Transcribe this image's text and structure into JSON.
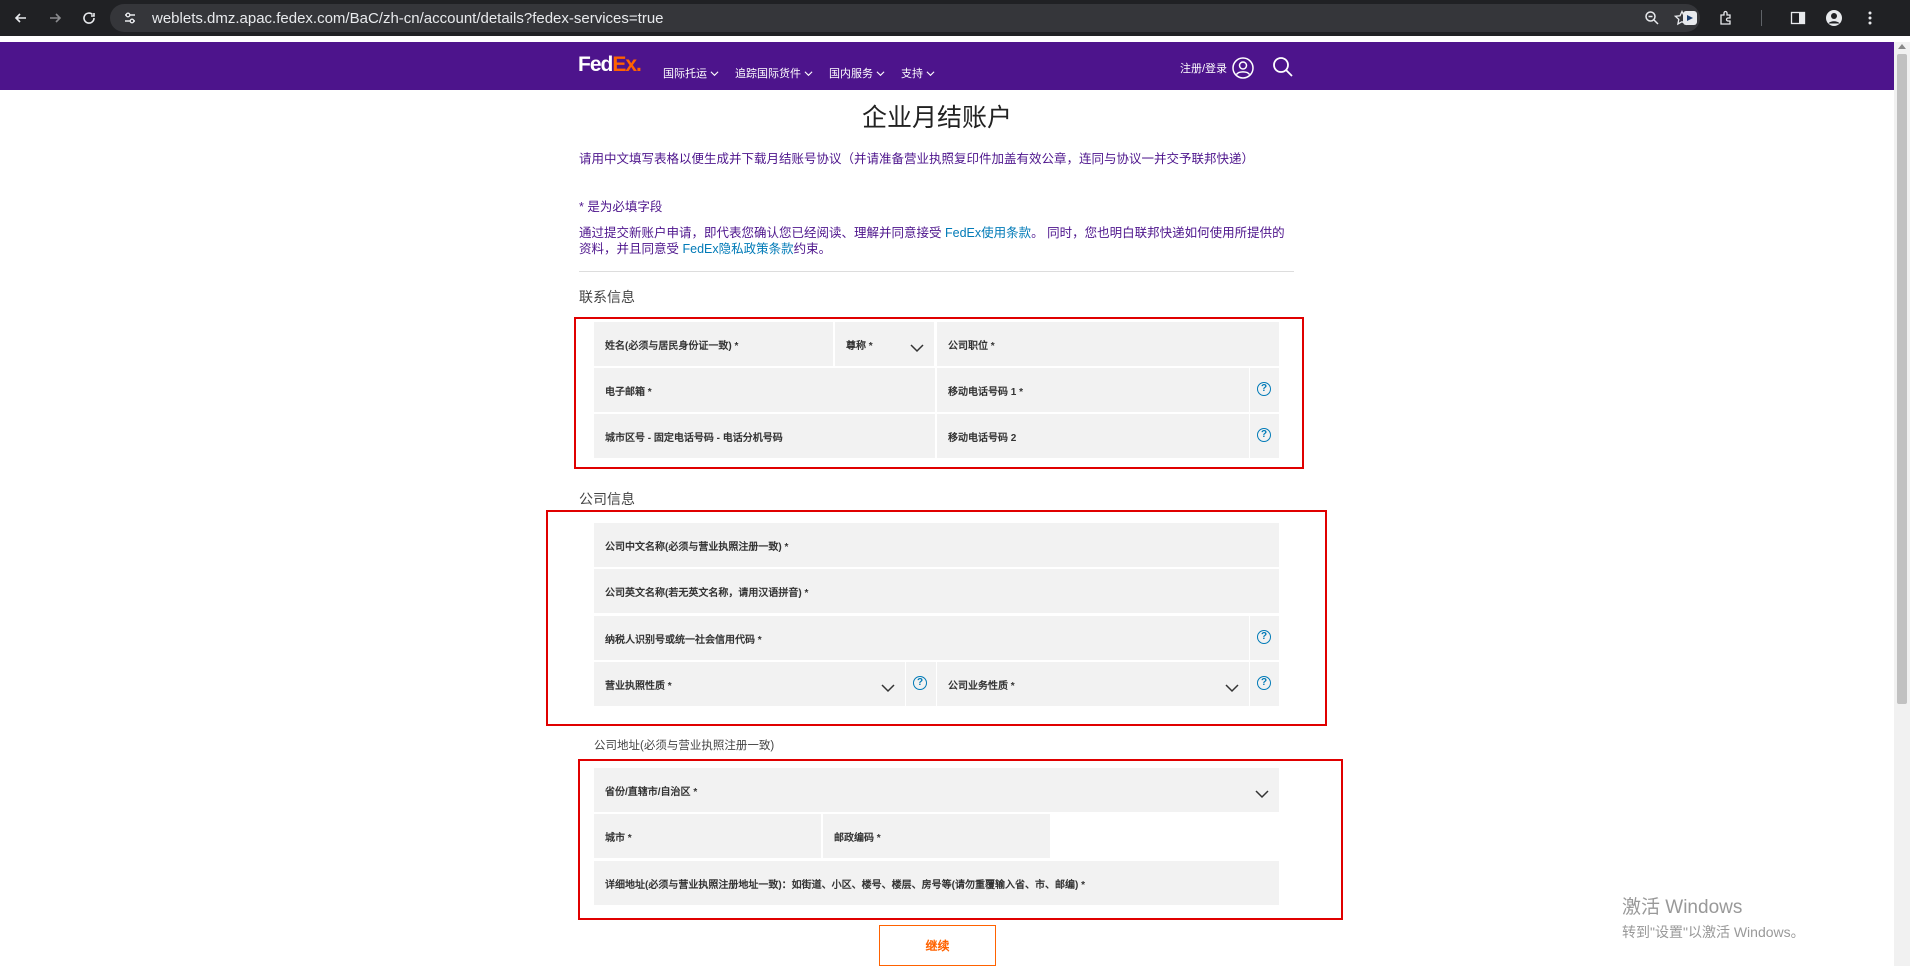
{
  "browser": {
    "url": "weblets.dmz.apac.fedex.com/BaC/zh-cn/account/details?fedex-services=true"
  },
  "header": {
    "logo_fed": "Fed",
    "logo_ex": "Ex.",
    "menu": [
      {
        "label": "国际托运"
      },
      {
        "label": "追踪国际货件"
      },
      {
        "label": "国内服务"
      },
      {
        "label": "支持"
      }
    ],
    "login_label": "注册/登录"
  },
  "page": {
    "title": "企业月结账户",
    "intro": "请用中文填写表格以便生成并下载月结账号协议（并请准备营业执照复印件加盖有效公章，连同与协议一并交予联邦快递）",
    "required_note": "* 是为必填字段",
    "terms_part1": "通过提交新账户申请，即代表您确认您已经阅读、理解并同意接受 ",
    "terms_link1": "FedEx使用条款",
    "terms_part2": "。 同时，您也明白联邦快递如何使用所提供的资料，并且同意受 ",
    "terms_link2": "FedEx隐私政策条款",
    "terms_part3": "约束。"
  },
  "contact": {
    "section_title": "联系信息",
    "name": "姓名(必须与居民身份证一致) *",
    "salutation": "尊称 *",
    "position": "公司职位 *",
    "email": "电子邮箱 *",
    "mobile1": "移动电话号码 1 *",
    "landline": "城市区号 - 固定电话号码 - 电话分机号码",
    "mobile2": "移动电话号码 2"
  },
  "company": {
    "section_title": "公司信息",
    "name_cn": "公司中文名称(必须与营业执照注册一致) *",
    "name_en": "公司英文名称(若无英文名称，请用汉语拼音) *",
    "tax_id": "纳税人识别号或统一社会信用代码 *",
    "license_type": "营业执照性质 *",
    "business_type": "公司业务性质 *"
  },
  "address": {
    "section_title": "公司地址(必须与营业执照注册一致)",
    "province": "省份/直辖市/自治区 *",
    "city": "城市 *",
    "postal": "邮政编码 *",
    "detail": "详细地址(必须与营业执照注册地址一致)：如街道、小区、楼号、楼层、房号等(请勿重覆输入省、市、邮编) *"
  },
  "continue_label": "继续",
  "watermark": {
    "title": "激活 Windows",
    "subtitle": "转到\"设置\"以激活 Windows。"
  },
  "colors": {
    "fedex_purple": "#4d148c",
    "fedex_orange": "#ff6200",
    "link_blue": "#007ab7",
    "highlight_red": "#e00000"
  }
}
